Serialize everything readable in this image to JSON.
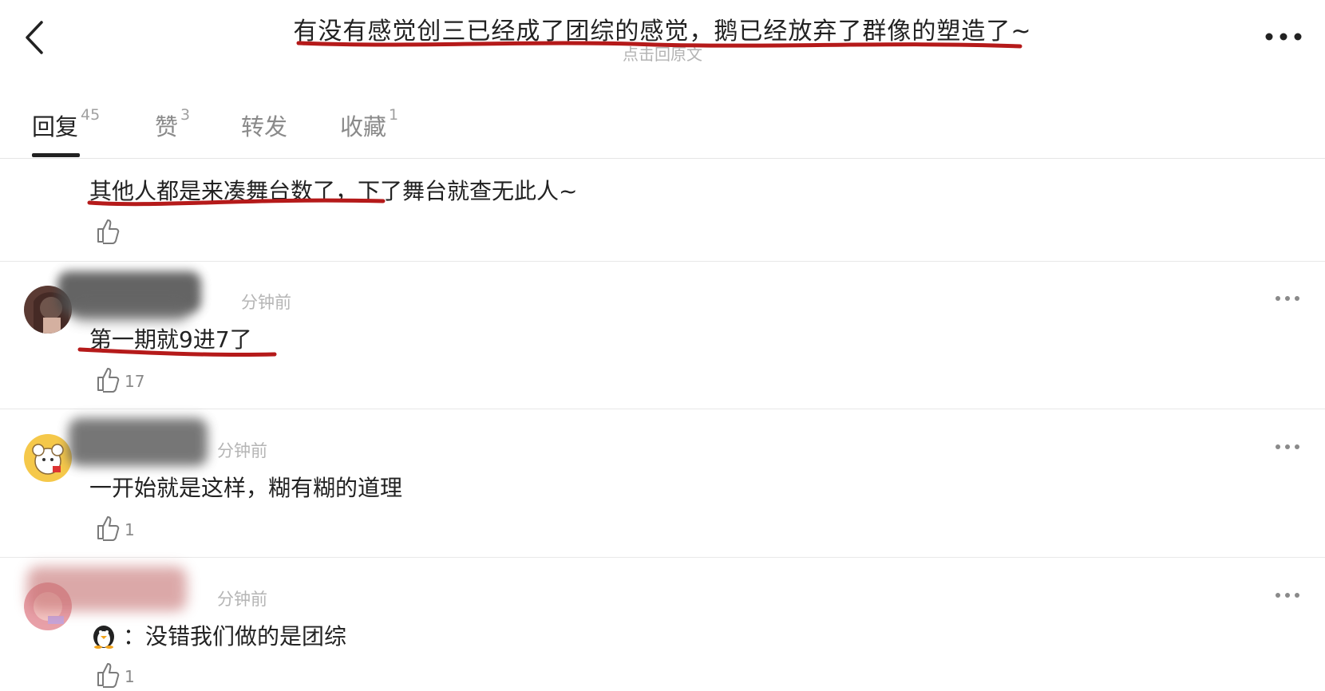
{
  "header": {
    "title": "有没有感觉创三已经成了团综的感觉，鹅已经放弃了群像的塑造了~",
    "subtitle": "点击回原文"
  },
  "tabs": [
    {
      "label": "回复",
      "count": "45"
    },
    {
      "label": "赞",
      "count": "3"
    },
    {
      "label": "转发",
      "count": ""
    },
    {
      "label": "收藏",
      "count": "1"
    }
  ],
  "comments": [
    {
      "text": "其他人都是来凑舞台数了，下了舞台就查无此人~",
      "likes": ""
    },
    {
      "time": "分钟前",
      "text": "第一期就9进7了",
      "likes": "17"
    },
    {
      "time": "分钟前",
      "text": "一开始就是这样，糊有糊的道理",
      "likes": "1"
    },
    {
      "time": "分钟前",
      "text": "：没错我们做的是团综",
      "likes": "1"
    }
  ],
  "colors": {
    "annotation_red": "#b51a1a",
    "muted_text": "#b5b5b5",
    "divider": "#e8e8e8"
  }
}
